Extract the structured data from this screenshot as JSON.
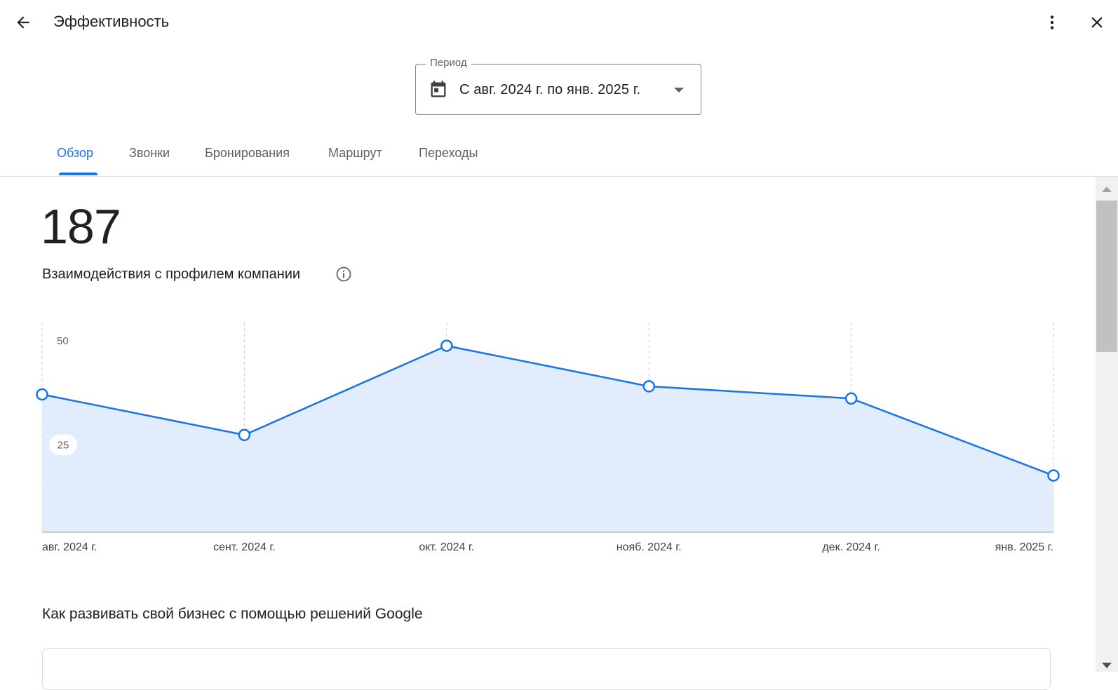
{
  "header": {
    "title": "Эффективность",
    "back_icon": "arrow-left-icon",
    "more_icon": "more-vert-icon",
    "close_icon": "close-icon"
  },
  "period": {
    "label": "Период",
    "value": "С авг. 2024 г. по янв. 2025 г.",
    "icon": "calendar-icon"
  },
  "tabs": [
    {
      "label": "Обзор",
      "active": true
    },
    {
      "label": "Звонки",
      "active": false
    },
    {
      "label": "Бронирования",
      "active": false
    },
    {
      "label": "Маршрут",
      "active": false
    },
    {
      "label": "Переходы",
      "active": false
    }
  ],
  "metric": {
    "value": "187",
    "label": "Взаимодействия с профилем компании"
  },
  "chart_data": {
    "type": "area",
    "categories": [
      "авг. 2024 г.",
      "сент. 2024 г.",
      "окт. 2024 г.",
      "нояб. 2024 г.",
      "дек. 2024 г.",
      "янв. 2025 г."
    ],
    "values": [
      34,
      24,
      46,
      36,
      33,
      14
    ],
    "yticks": [
      25,
      50
    ],
    "ylim": [
      0,
      50
    ],
    "grid": "vertical-dashed",
    "line_color": "#1a73e8",
    "fill_color": "#e1edfc"
  },
  "section": {
    "title": "Как развивать свой бизнес с помощью решений Google"
  },
  "colors": {
    "accent": "#1a73e8",
    "text": "#202124",
    "secondary": "#5f6368"
  }
}
